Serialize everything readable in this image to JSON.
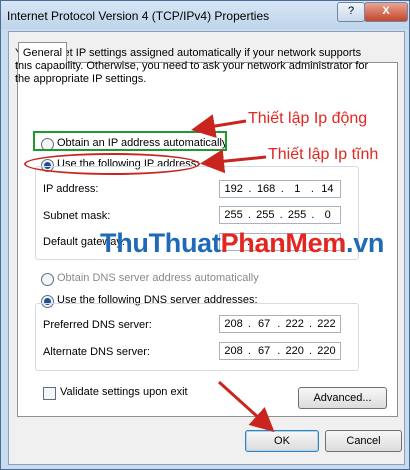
{
  "window": {
    "title": "Internet Protocol Version 4 (TCP/IPv4) Properties",
    "help_label": "?",
    "close_label": "X"
  },
  "tabs": {
    "general": "General"
  },
  "description": "You can get IP settings assigned automatically if your network supports this capability. Otherwise, you need to ask your network administrator for the appropriate IP settings.",
  "ip": {
    "auto_label": "Obtain an IP address automatically",
    "manual_label": "Use the following IP address:",
    "selected": "manual",
    "fields": [
      {
        "label": "IP address:",
        "octets": [
          "192",
          "168",
          "1",
          "14"
        ]
      },
      {
        "label": "Subnet mask:",
        "octets": [
          "255",
          "255",
          "255",
          "0"
        ]
      },
      {
        "label": "Default gateway:",
        "octets": [
          "",
          "",
          "",
          ""
        ]
      }
    ]
  },
  "dns": {
    "auto_label": "Obtain DNS server address automatically",
    "manual_label": "Use the following DNS server addresses:",
    "selected": "manual",
    "fields": [
      {
        "label": "Preferred DNS server:",
        "octets": [
          "208",
          "67",
          "222",
          "222"
        ]
      },
      {
        "label": "Alternate DNS server:",
        "octets": [
          "208",
          "67",
          "220",
          "220"
        ]
      }
    ]
  },
  "validate_label": "Validate settings upon exit",
  "buttons": {
    "advanced": "Advanced...",
    "ok": "OK",
    "cancel": "Cancel"
  },
  "annotations": {
    "dynamic": "Thiết lập Ip động",
    "static": "Thiết lập Ip tĩnh"
  },
  "watermark": {
    "part1": "ThuThuat",
    "part2": "PhanMem",
    "part3": ".vn"
  },
  "colors": {
    "annotation": "#e3261f",
    "highlight_green": "#1f9a2e",
    "watermark_blue": "#1e6ab7"
  }
}
